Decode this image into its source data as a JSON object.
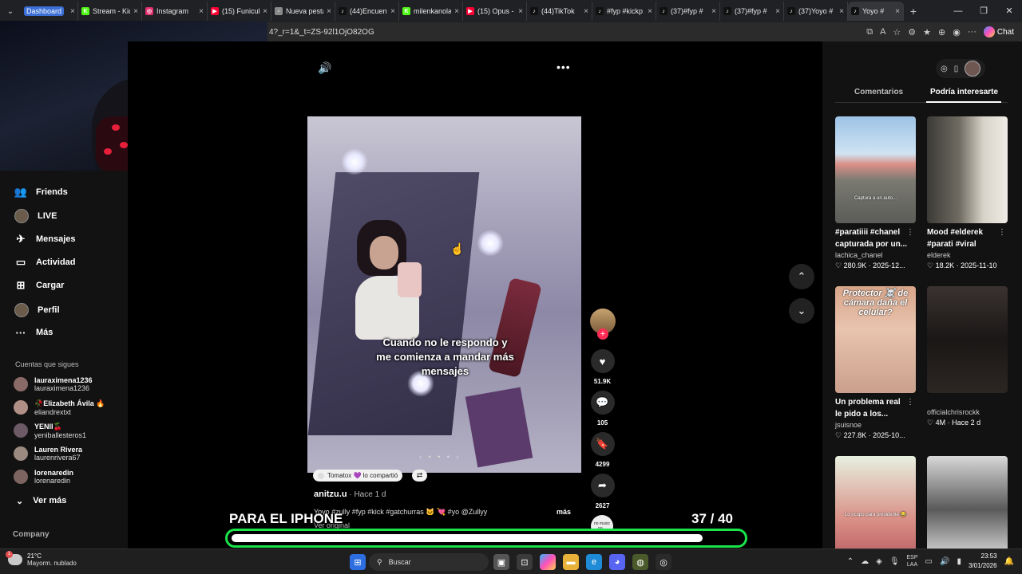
{
  "browser": {
    "tabs": [
      {
        "label": "Dashboard",
        "fav": "",
        "color": "#3b6fd6",
        "badge": true
      },
      {
        "label": "Stream - Kick",
        "fav": "K",
        "color": "#53fc18"
      },
      {
        "label": "Instagram",
        "fav": "◎",
        "color": "#e1306c"
      },
      {
        "label": "(15) Funicul",
        "fav": "▶",
        "color": "#ff0033"
      },
      {
        "label": "Nueva pesta",
        "fav": "▫",
        "color": "#8a8a8a"
      },
      {
        "label": "(44)Encuent",
        "fav": "♪",
        "color": "#111111"
      },
      {
        "label": "milenkanola",
        "fav": "K",
        "color": "#53fc18"
      },
      {
        "label": "(15) Opus -",
        "fav": "▶",
        "color": "#ff0033"
      },
      {
        "label": "(44)TikTok",
        "fav": "♪",
        "color": "#111111"
      },
      {
        "label": "#fyp #kickp",
        "fav": "♪",
        "color": "#111111"
      },
      {
        "label": "(37)#fyp #",
        "fav": "♪",
        "color": "#111111"
      },
      {
        "label": "(37)#fyp #",
        "fav": "♪",
        "color": "#111111"
      },
      {
        "label": "(37)Yoyo #",
        "fav": "♪",
        "color": "#111111"
      },
      {
        "label": "Yoyo #",
        "fav": "♪",
        "color": "#111111",
        "active": true
      }
    ],
    "url": "4?_r=1&_t=ZS-92l1OjO82OG",
    "chat_label": "Chat"
  },
  "sidebar": {
    "items": [
      {
        "label": "Friends",
        "icon": "👥"
      },
      {
        "label": "LIVE",
        "icon": "avatar"
      },
      {
        "label": "Mensajes",
        "icon": "✈"
      },
      {
        "label": "Actividad",
        "icon": "▭"
      },
      {
        "label": "Cargar",
        "icon": "⊞"
      },
      {
        "label": "Perfil",
        "icon": "avatar"
      },
      {
        "label": "Más",
        "icon": "···"
      }
    ],
    "following_title": "Cuentas que sigues",
    "accounts": [
      {
        "name": "lauraximena1236",
        "user": "lauraximena1236"
      },
      {
        "name": "🥀Elizabeth Ávila 🔥",
        "user": "eliandrextxt"
      },
      {
        "name": "YENII🍒",
        "user": "yeniballesteros1"
      },
      {
        "name": "Lauren Rivera",
        "user": "laurenrivera67"
      },
      {
        "name": "lorenaredin",
        "user": "lorenaredin"
      }
    ],
    "see_more": "Ver más",
    "company": "Company"
  },
  "video": {
    "caption": "Cuando no le respondo y me comienza a mandar más mensajes",
    "shared_label": "Tomatox 💜 lo compartió",
    "author": "anitzu.u",
    "time": " · Hace 1 d",
    "description": "Yoyo #zully #fyp #kick #gatchurras 🐱 💘 #yo @Zullyy",
    "more": "más",
    "original": "Ver original",
    "music": "no music no...",
    "likes": "51.9K",
    "comments": "105",
    "saves": "4299",
    "shares": "2627"
  },
  "right_panel": {
    "tabs": [
      "Comentarios",
      "Podría interesarte"
    ],
    "cards": [
      {
        "title": "#paratiiii #chanel capturada por un...",
        "author": "lachica_chanel",
        "stats": "♡ 280.9K · 2025-12...",
        "overlay": "Captura a un auto...",
        "bg": "linear-gradient(#9ec3e6 0%,#cfe3f2 35%,#d98f86 45%,#7a7a72 60%,#5c5c58 100%)"
      },
      {
        "title": "Mood #elderek #parati #viral",
        "author": "elderek",
        "stats": "♡ 18.2K · 2025-11-10",
        "overlay": "",
        "bg": "linear-gradient(90deg,#3b3a36 0%,#6f6b62 40%,#d7d3c8 70%,#efece6 100%)"
      },
      {
        "title": "Un problema real le pido a los...",
        "author": "jsuisnoe",
        "stats": "♡ 227.8K · 2025-10...",
        "overlay": "Protector ☠️ de cámara daña el celular?",
        "bg": "linear-gradient(#d7a58a 0%,#e9c4ae 40%,#caa08c 100%)"
      },
      {
        "title": "",
        "author": "officialchrisrockk",
        "stats": "♡ 4M · Hace 2 d",
        "overlay": "",
        "bg": "linear-gradient(#3a3230 0%,#1a1716 50%,#2c2623 100%)"
      },
      {
        "title": "",
        "author": "",
        "stats": "",
        "overlay": "Lo ocupo para presidente 😂",
        "bg": "linear-gradient(#e7f0e0 0%,#d98f86 60%,#b85a62 100%)"
      },
      {
        "title": "",
        "author": "",
        "stats": "",
        "overlay": "",
        "bg": "linear-gradient(#d8d8d8 0%,#5a5a5a 50%,#e8e8e8 100%)"
      }
    ]
  },
  "overlay": {
    "text": "PARA EL IPHONE",
    "current": "37",
    "total": "/ 40",
    "progress": 0.925,
    "accent": "#19e44a"
  },
  "taskbar": {
    "temp": "21°C",
    "weather": "Mayorm. nublado",
    "weather_badge": "1",
    "search": "Buscar",
    "lang_top": "ESP",
    "lang_bottom": "LAA",
    "time": "23:53",
    "date": "3/01/2026"
  }
}
